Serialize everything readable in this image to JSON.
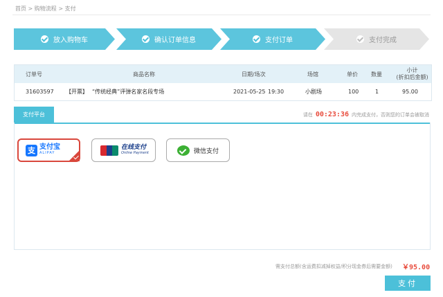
{
  "breadcrumb": {
    "text": "首页 > 购物流程 > 支付"
  },
  "steps": [
    {
      "label": "放入购物车",
      "status": "done"
    },
    {
      "label": "确认订单信息",
      "status": "done"
    },
    {
      "label": "支付订单",
      "status": "done"
    },
    {
      "label": "支付完成",
      "status": "pending"
    }
  ],
  "order_table": {
    "headers": {
      "order_no": "订单号",
      "product": "商品名称",
      "date": "日期/场次",
      "venue": "场馆",
      "price": "单价",
      "qty": "数量",
      "subtotal_line1": "小计",
      "subtotal_line2": "(折扣后金额)"
    },
    "row": {
      "order_no": "31603597",
      "tag": "【开票】",
      "product": "“传统经典”评弹名家名段专场",
      "date": "2021-05-25",
      "time": "19:30",
      "venue": "小剧场",
      "price": "100",
      "qty": "1",
      "subtotal": "95.00"
    }
  },
  "payment": {
    "tab_label": "支付平台",
    "timer_prefix": "请在",
    "timer_value": "00:23:36",
    "timer_suffix": "内完成支付，否则您的订单会被取消",
    "options": {
      "alipay": {
        "cn": "支付宝",
        "en": "ALIPAY",
        "selected": true
      },
      "unionpay": {
        "badge": "UnionPay 银联",
        "cn": "在线支付",
        "en": "Online Payment"
      },
      "wechat": {
        "label": "微信支付"
      }
    }
  },
  "summary": {
    "total_label": "需支付总额(含运费扣减掉权益/积分现金券后需要金额)",
    "total_amount": "￥95.00"
  },
  "actions": {
    "pay_label": "支付"
  },
  "colors": {
    "accent": "#4cc0d9",
    "price": "#e84c3d",
    "selected_border": "#d9473c"
  }
}
